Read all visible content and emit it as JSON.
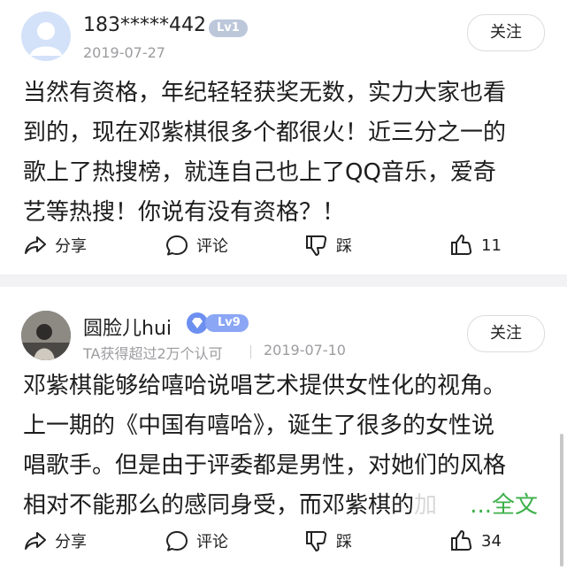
{
  "comments": [
    {
      "username": "183*****442",
      "level": "Lv1",
      "date": "2019-07-27",
      "follow_label": "关注",
      "content_lines": [
        "当然有资格，年纪轻轻获奖无数，实力大家也看",
        "到的，现在邓紫棋很多个都很火！近三分之一的",
        "歌上了热搜榜，就连自己也上了QQ音乐，爱奇",
        "艺等热搜！你说有没有资格？！"
      ],
      "share_label": "分享",
      "comment_label": "评论",
      "dislike_label": "踩",
      "like_count": "11"
    },
    {
      "username": "圆脸儿hui",
      "level": "Lv9",
      "recognition": "TA获得超过2万个认可",
      "date": "2019-07-10",
      "follow_label": "关注",
      "content_lines": [
        "邓紫棋能够给嘻哈说唱艺术提供女性化的视角。",
        "上一期的《中国有嘻哈》，诞生了很多的女性说",
        "唱歌手。但是由于评委都是男性，对她们的风格",
        "相对不能那么的感同身受，而邓紫棋的",
        "加"
      ],
      "more_label": "...全文",
      "share_label": "分享",
      "comment_label": "评论",
      "dislike_label": "踩",
      "like_count": "34"
    }
  ],
  "colors": {
    "accent_green": "#3cb04a",
    "level_badge_gray": "#bcc7da",
    "level_badge_blue": "#8aa6f5"
  },
  "icons": [
    "share-icon",
    "comment-icon",
    "dislike-icon",
    "like-icon",
    "diamond-badge-icon",
    "avatar-placeholder-icon"
  ]
}
